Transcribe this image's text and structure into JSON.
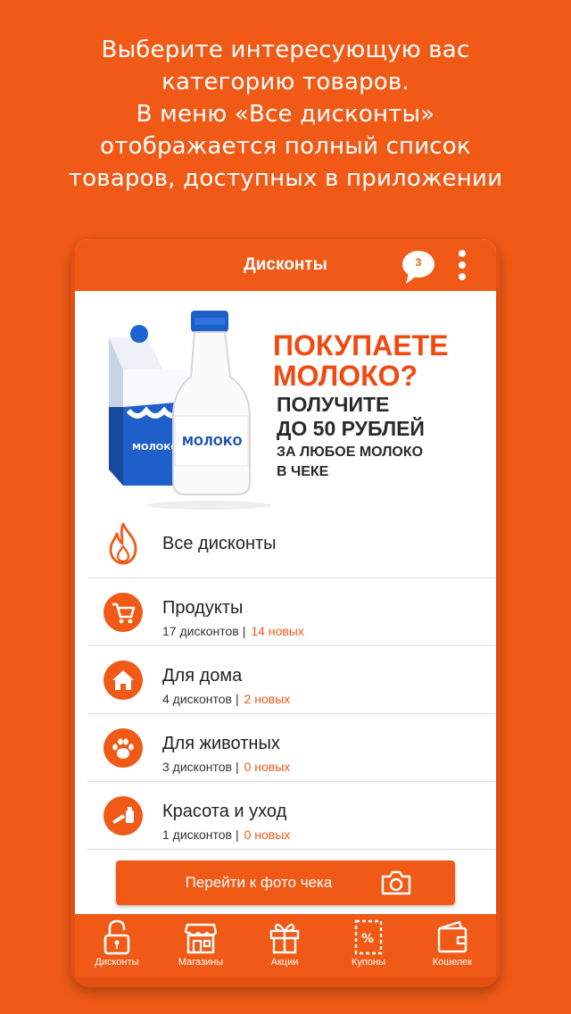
{
  "promo": {
    "line1": "Выберите интересующую вас",
    "line2": "категорию товаров.",
    "line3": "В меню «Все дисконты»",
    "line4": "отображается полный список",
    "line5": "товаров, доступных в приложении"
  },
  "appbar": {
    "title": "Дисконты",
    "chat_count": "3",
    "chat_icon": "chat-bubble-icon",
    "menu_icon": "more-vertical-icon"
  },
  "banner": {
    "headline_line1": "ПОКУПАЕТЕ",
    "headline_line2": "МОЛОКО?",
    "offer_line1": "ПОЛУЧИТЕ",
    "offer_line2": "ДО 50 РУБЛЕЙ",
    "detail_line1": "ЗА ЛЮБОЕ МОЛОКО",
    "detail_line2": "В ЧЕКЕ",
    "carton_label": "МОЛОКО",
    "bottle_label": "МОЛОКО"
  },
  "categories": [
    {
      "name": "Все дисконты",
      "icon": "flame-icon"
    },
    {
      "name": "Продукты",
      "count": "17 дисконтов",
      "new": "14 новых",
      "icon": "cart-icon"
    },
    {
      "name": "Для дома",
      "count": "4 дисконтов",
      "new": "2 новых",
      "icon": "home-icon"
    },
    {
      "name": "Для животных",
      "count": "3 дисконтов",
      "new": "0 новых",
      "icon": "paw-icon"
    },
    {
      "name": "Красота и уход",
      "count": "1 дисконтов",
      "new": "0 новых",
      "icon": "cosmetics-icon"
    }
  ],
  "separator": "|",
  "photo_button": {
    "label": "Перейти к фото чека",
    "icon": "camera-icon"
  },
  "tabs": [
    {
      "label": "Дисконты",
      "icon": "unlock-icon"
    },
    {
      "label": "Магазины",
      "icon": "store-icon"
    },
    {
      "label": "Акции",
      "icon": "gift-icon"
    },
    {
      "label": "Купоны",
      "icon": "coupon-percent-icon"
    },
    {
      "label": "Кошелек",
      "icon": "wallet-icon"
    }
  ],
  "colors": {
    "accent": "#f05a16",
    "background": "#f05a16",
    "text": "#222222"
  }
}
